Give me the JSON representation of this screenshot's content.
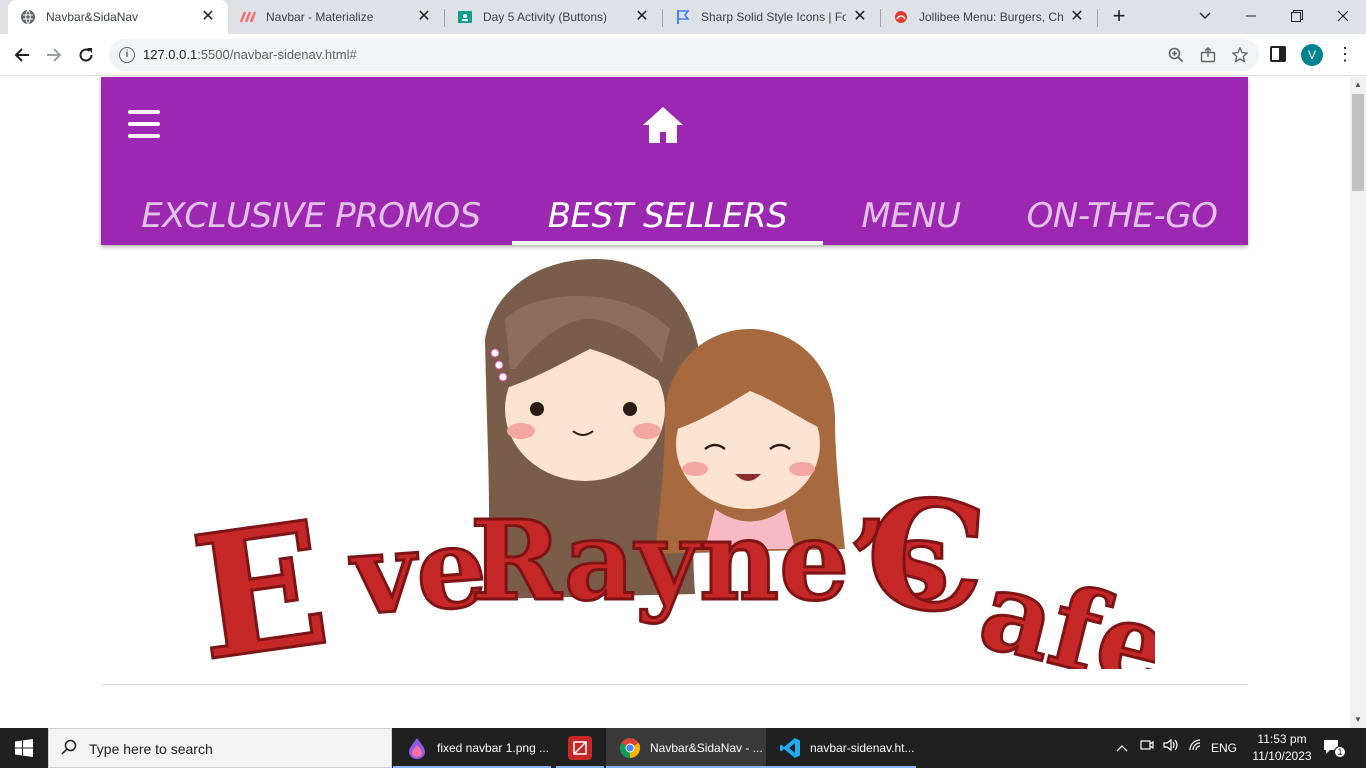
{
  "browser": {
    "tabs": [
      {
        "title": "Navbar&SidaNav",
        "favicon": "globe-icon",
        "active": true
      },
      {
        "title": "Navbar - Materialize",
        "favicon": "materialize-icon",
        "active": false
      },
      {
        "title": "Day 5 Activity (Buttons)",
        "favicon": "classroom-icon",
        "active": false
      },
      {
        "title": "Sharp Solid Style Icons | Font",
        "favicon": "flag-icon",
        "active": false
      },
      {
        "title": "Jollibee Menu: Burgers, Chic",
        "favicon": "jollibee-icon",
        "active": false
      }
    ],
    "new_tab_label": "+",
    "url_host": "127.0.0.1",
    "url_rest": ":5500/navbar-sidenav.html#",
    "profile_initial": "V"
  },
  "page": {
    "nav_tabs": [
      {
        "label": "Exclusive Promos",
        "active": false
      },
      {
        "label": "Best Sellers",
        "active": true
      },
      {
        "label": "Menu",
        "active": false
      },
      {
        "label": "On-the-go",
        "active": false
      }
    ],
    "logo_text": "EveRayne's Cafe",
    "colors": {
      "navbar": "#9c27b0",
      "logo_red": "#c62828"
    }
  },
  "taskbar": {
    "search_placeholder": "Type here to search",
    "apps": [
      {
        "label": "fixed navbar 1.png ...",
        "icon": "paint3d-icon"
      },
      {
        "label": "",
        "icon": "snipping-icon"
      },
      {
        "label": "Navbar&SidaNav - ...",
        "icon": "chrome-icon"
      },
      {
        "label": "navbar-sidenav.ht...",
        "icon": "vscode-icon"
      }
    ],
    "language": "ENG",
    "time": "11:53 pm",
    "date": "11/10/2023",
    "notification_count": "1"
  }
}
